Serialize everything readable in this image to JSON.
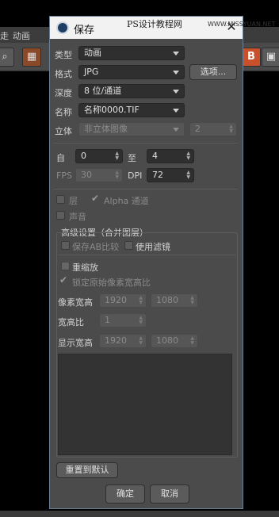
{
  "app": {
    "menu": [
      "走",
      "动画"
    ],
    "toolbar_badge": "B"
  },
  "watermark": {
    "line1": "PS设计教程网",
    "line2": "WWW.MISSYUAN.NET"
  },
  "dialog": {
    "title": "保存",
    "close": "✕",
    "type_label": "类型",
    "type_value": "动画",
    "format_label": "格式",
    "format_value": "JPG",
    "options_button": "选项...",
    "depth_label": "深度",
    "depth_value": "8 位/通道",
    "name_label": "名称",
    "name_value": "名称0000.TIF",
    "stereo_label": "立体",
    "stereo_value": "非立体图像",
    "stereo_num": "2",
    "from_label": "自",
    "from_value": "0",
    "to_label": "至",
    "to_value": "4",
    "fps_label": "FPS",
    "fps_value": "30",
    "dpi_label": "DPI",
    "dpi_value": "72",
    "layers_label": "层",
    "alpha_label": "Alpha 通道",
    "sound_label": "声音",
    "advanced_title": "高级设置（合并图层）",
    "keep_ab_label": "保存AB比较",
    "use_filter_label": "使用滤镜",
    "rescale_label": "重缩放",
    "lock_ratio_label": "锁定原始像素宽高比",
    "pixel_wh_label": "像素宽高",
    "pixel_w": "1920",
    "pixel_h": "1080",
    "aspect_label": "宽高比",
    "aspect_value": "1",
    "display_wh_label": "显示宽高",
    "display_w": "1920",
    "display_h": "1080",
    "reset_button": "重置到默认",
    "ok_button": "确定",
    "cancel_button": "取消"
  }
}
